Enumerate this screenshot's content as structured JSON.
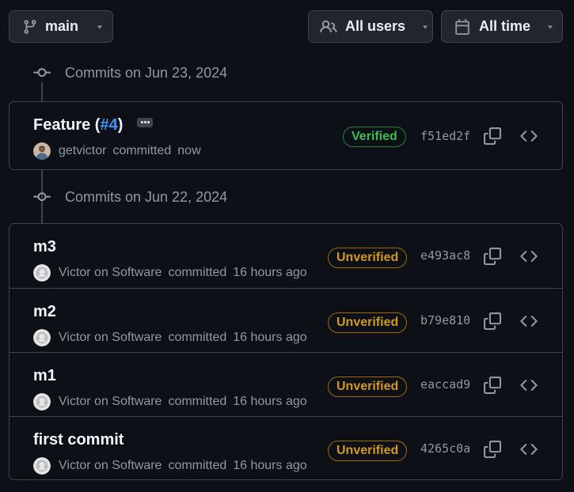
{
  "toolbar": {
    "branch_label": "main",
    "branch_icon": "git-branch-icon",
    "users_label": "All users",
    "users_icon": "people-icon",
    "time_label": "All time",
    "time_icon": "calendar-icon"
  },
  "colors": {
    "background": "#0d1117",
    "border": "#3d444d",
    "link": "#4493f8",
    "verified": "#3fb950",
    "unverified": "#d29922"
  },
  "groups": [
    {
      "header": "Commits on Jun 23, 2024",
      "commits": [
        {
          "title_prefix": "Feature (",
          "pr_link": "#4",
          "title_suffix": ")",
          "has_more": true,
          "author": "getvictor",
          "action": "committed",
          "time": "now",
          "badge": "Verified",
          "sha": "f51ed2f"
        }
      ]
    },
    {
      "header": "Commits on Jun 22, 2024",
      "commits": [
        {
          "title": "m3",
          "author": "Victor on Software",
          "action": "committed",
          "time": "16 hours ago",
          "badge": "Unverified",
          "sha": "e493ac8"
        },
        {
          "title": "m2",
          "author": "Victor on Software",
          "action": "committed",
          "time": "16 hours ago",
          "badge": "Unverified",
          "sha": "b79e810"
        },
        {
          "title": "m1",
          "author": "Victor on Software",
          "action": "committed",
          "time": "16 hours ago",
          "badge": "Unverified",
          "sha": "eaccad9"
        },
        {
          "title": "first commit",
          "author": "Victor on Software",
          "action": "committed",
          "time": "16 hours ago",
          "badge": "Unverified",
          "sha": "4265c0a"
        }
      ]
    }
  ]
}
